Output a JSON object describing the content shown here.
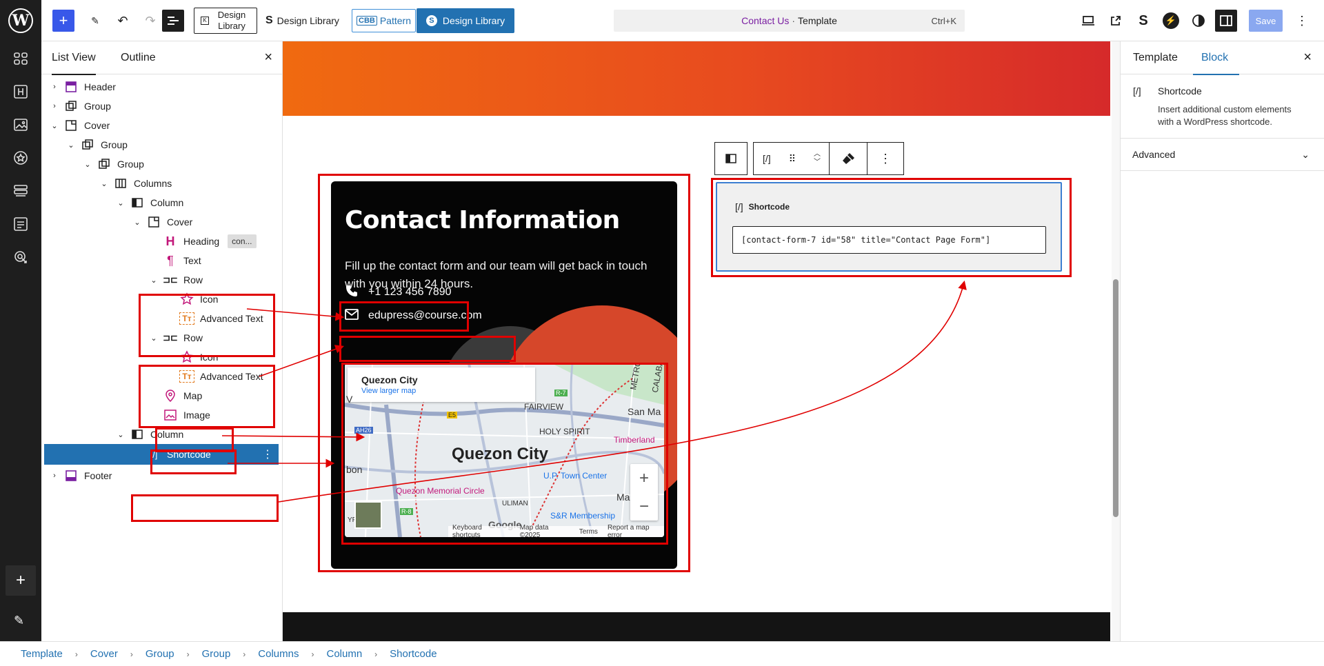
{
  "topbar": {
    "design_library_1": "Design Library",
    "design_library_2": "Design Library",
    "pattern_prefix": "CBB",
    "pattern_label": "Pattern",
    "design_library_3": "Design Library",
    "command": {
      "link": "Contact Us",
      "sep": "·",
      "rest": "Template",
      "shortcut": "Ctrl+K"
    },
    "save_label": "Save"
  },
  "listview": {
    "tabs": [
      {
        "label": "List View"
      },
      {
        "label": "Outline"
      }
    ],
    "items": [
      {
        "label": "Header"
      },
      {
        "label": "Group"
      },
      {
        "label": "Cover"
      },
      {
        "label": "Group"
      },
      {
        "label": "Group"
      },
      {
        "label": "Columns"
      },
      {
        "label": "Column"
      },
      {
        "label": "Cover"
      },
      {
        "label": "Heading",
        "badge": "con..."
      },
      {
        "label": "Text"
      },
      {
        "label": "Row"
      },
      {
        "label": "Icon"
      },
      {
        "label": "Advanced Text"
      },
      {
        "label": "Row"
      },
      {
        "label": "Icon"
      },
      {
        "label": "Advanced Text"
      },
      {
        "label": "Map"
      },
      {
        "label": "Image"
      },
      {
        "label": "Column"
      },
      {
        "label": "Shortcode"
      },
      {
        "label": "Footer"
      }
    ]
  },
  "contact": {
    "title": "Contact Information",
    "description": "Fill up the contact form and our team will get back in touch with you within 24 hours.",
    "phone": "+1 123 456 7890",
    "email": "edupress@course.com"
  },
  "map": {
    "place": "Quezon City",
    "larger_map": "View larger map",
    "city_label": "Quezon City",
    "labels": {
      "fairview": "FAIRVIEW",
      "metro": "METRO",
      "calaba": "CALABA",
      "san_ma": "San Ma",
      "holy_spirit": "HOLY SPIRIT",
      "timberland": "Timberland",
      "bon": "bon",
      "v": "V",
      "town_center": "U.P. Town Center",
      "memorial": "Quezon Memorial Circle",
      "marikin": "Marikin",
      "uliman": "ULIMAN",
      "membership": "S&R Membership",
      "ypajo": "YPAJO",
      "ah26": "AH26",
      "e5": "E5",
      "r7": "R-7",
      "r8": "R-8"
    },
    "google": "Google",
    "attribution": {
      "keyboard": "Keyboard shortcuts",
      "data": "Map data ©2025",
      "terms": "Terms",
      "report": "Report a map error"
    },
    "zoom_in": "+",
    "zoom_out": "−"
  },
  "shortcode": {
    "block_label": "Shortcode",
    "value": "[contact-form-7 id=\"58\" title=\"Contact Page Form\"]"
  },
  "settings": {
    "tabs": [
      {
        "label": "Template"
      },
      {
        "label": "Block"
      }
    ],
    "block_name": "Shortcode",
    "block_desc": "Insert additional custom elements with a WordPress shortcode.",
    "advanced": "Advanced"
  },
  "breadcrumb": [
    "Template",
    "Cover",
    "Group",
    "Group",
    "Columns",
    "Column",
    "Shortcode"
  ],
  "colors": {
    "accent": "#2271b1",
    "annotation": "#e00000",
    "wp_blue": "#3858e9"
  }
}
